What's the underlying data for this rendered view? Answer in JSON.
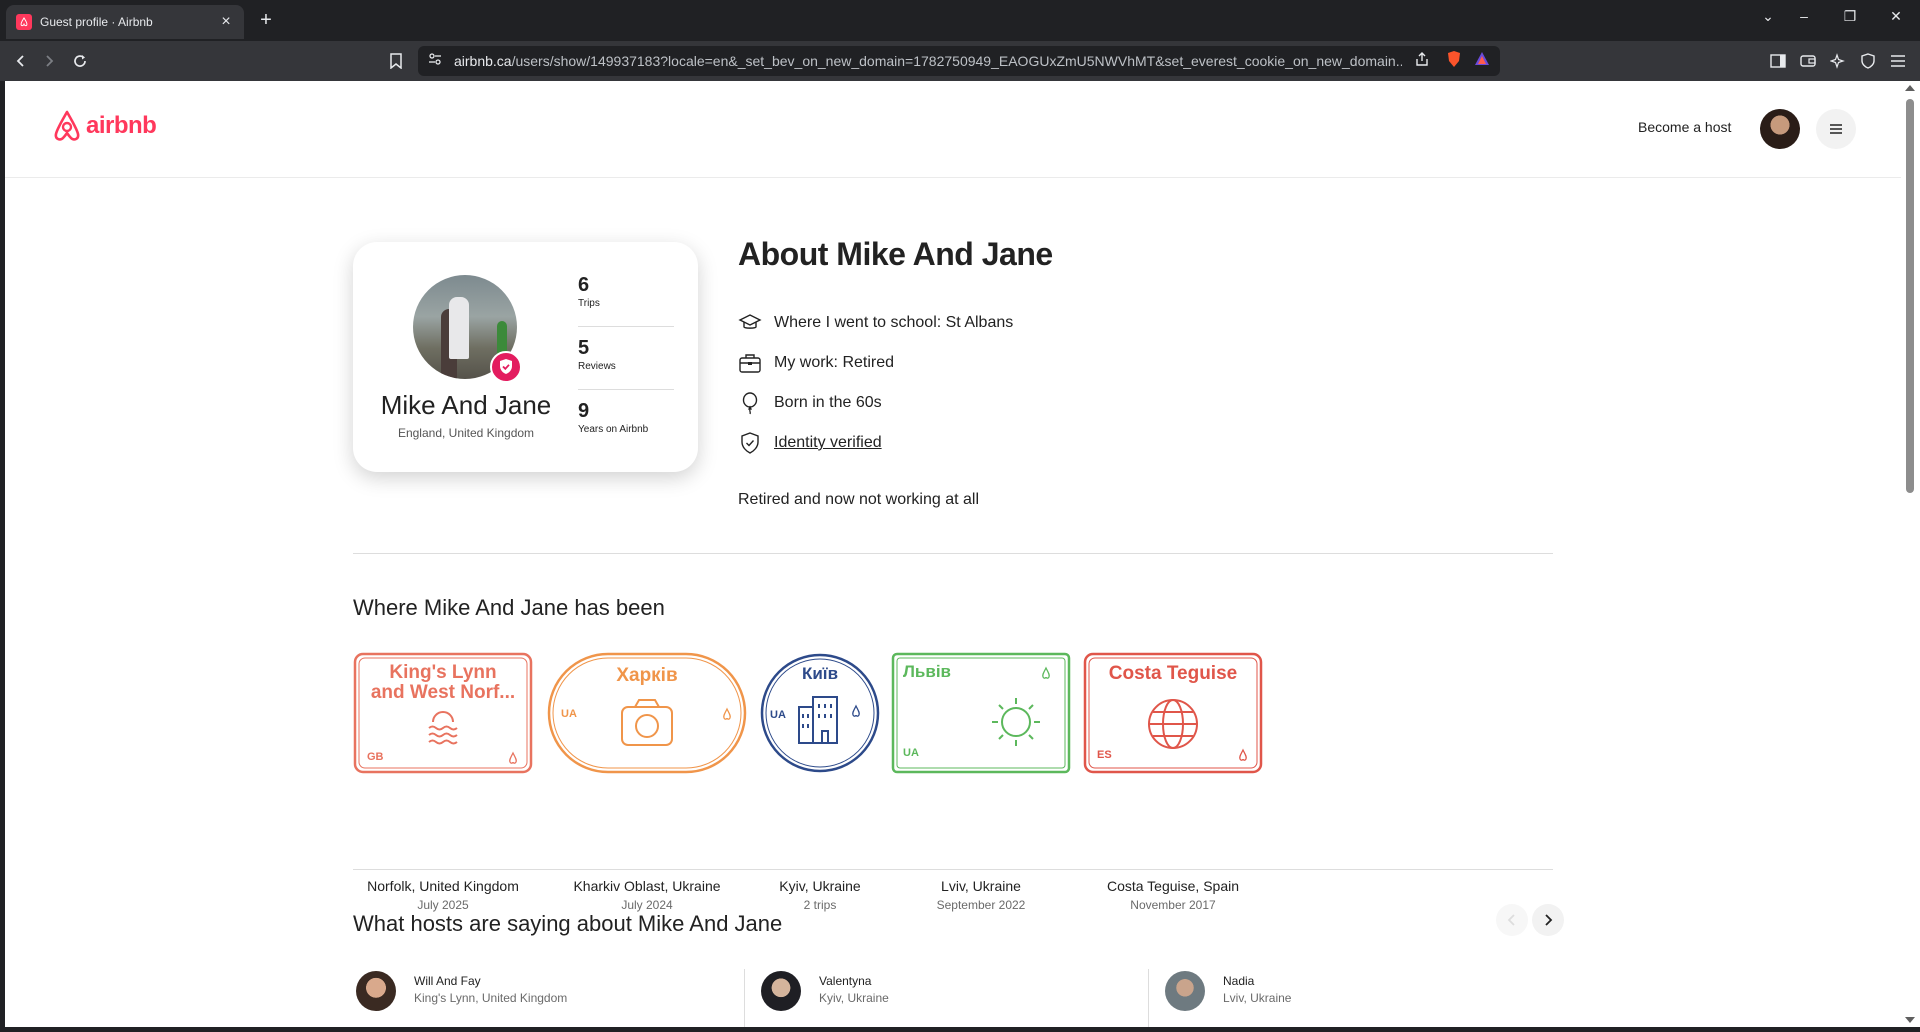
{
  "browser": {
    "tab_title": "Guest profile · Airbnb",
    "url_host": "airbnb.ca",
    "url_path": "/users/show/149937183?locale=en&_set_bev_on_new_domain=1782750949_EAOGUxZmU5NWVhMT&set_everest_cookie_on_new_domain..."
  },
  "header": {
    "logo_text": "airbnb",
    "become_host": "Become a host"
  },
  "profile": {
    "name": "Mike And Jane",
    "location": "England, United Kingdom",
    "stats": [
      {
        "value": "6",
        "label": "Trips"
      },
      {
        "value": "5",
        "label": "Reviews"
      },
      {
        "value": "9",
        "label": "Years on Airbnb"
      }
    ]
  },
  "about": {
    "title": "About Mike And Jane",
    "items": [
      {
        "icon": "graduation-cap-icon",
        "text": "Where I went to school: St Albans"
      },
      {
        "icon": "briefcase-icon",
        "text": "My work: Retired"
      },
      {
        "icon": "balloon-icon",
        "text": "Born in the 60s"
      },
      {
        "icon": "shield-check-icon",
        "text": "Identity verified"
      }
    ],
    "bio": "Retired and now not working at all"
  },
  "places": {
    "title": "Where Mike And Jane has been",
    "stamps": [
      {
        "stamp_line1": "King's Lynn",
        "stamp_line2": "and West Norf...",
        "code": "GB",
        "place": "Norfolk, United Kingdom",
        "date": "July 2025",
        "color": "#e8735f"
      },
      {
        "stamp_line1": "Харків",
        "stamp_line2": "",
        "code": "UA",
        "place": "Kharkiv Oblast, Ukraine",
        "date": "July 2024",
        "color": "#f0954a"
      },
      {
        "stamp_line1": "Київ",
        "stamp_line2": "",
        "code": "UA",
        "place": "Kyiv, Ukraine",
        "date": "2 trips",
        "color": "#2d4a8a"
      },
      {
        "stamp_line1": "Львів",
        "stamp_line2": "",
        "code": "UA",
        "place": "Lviv, Ukraine",
        "date": "September 2022",
        "color": "#5cb85c"
      },
      {
        "stamp_line1": "Costa Teguise",
        "stamp_line2": "",
        "code": "ES",
        "place": "Costa Teguise, Spain",
        "date": "November 2017",
        "color": "#e0564a"
      }
    ]
  },
  "reviews": {
    "title": "What hosts are saying about Mike And Jane",
    "hosts": [
      {
        "name": "Will And Fay",
        "location": "King's Lynn, United Kingdom"
      },
      {
        "name": "Valentyna",
        "location": "Kyiv, Ukraine"
      },
      {
        "name": "Nadia",
        "location": "Lviv, Ukraine"
      }
    ]
  },
  "colors": {
    "brand": "#ff385c",
    "verified_badge": "#e31c5f"
  }
}
